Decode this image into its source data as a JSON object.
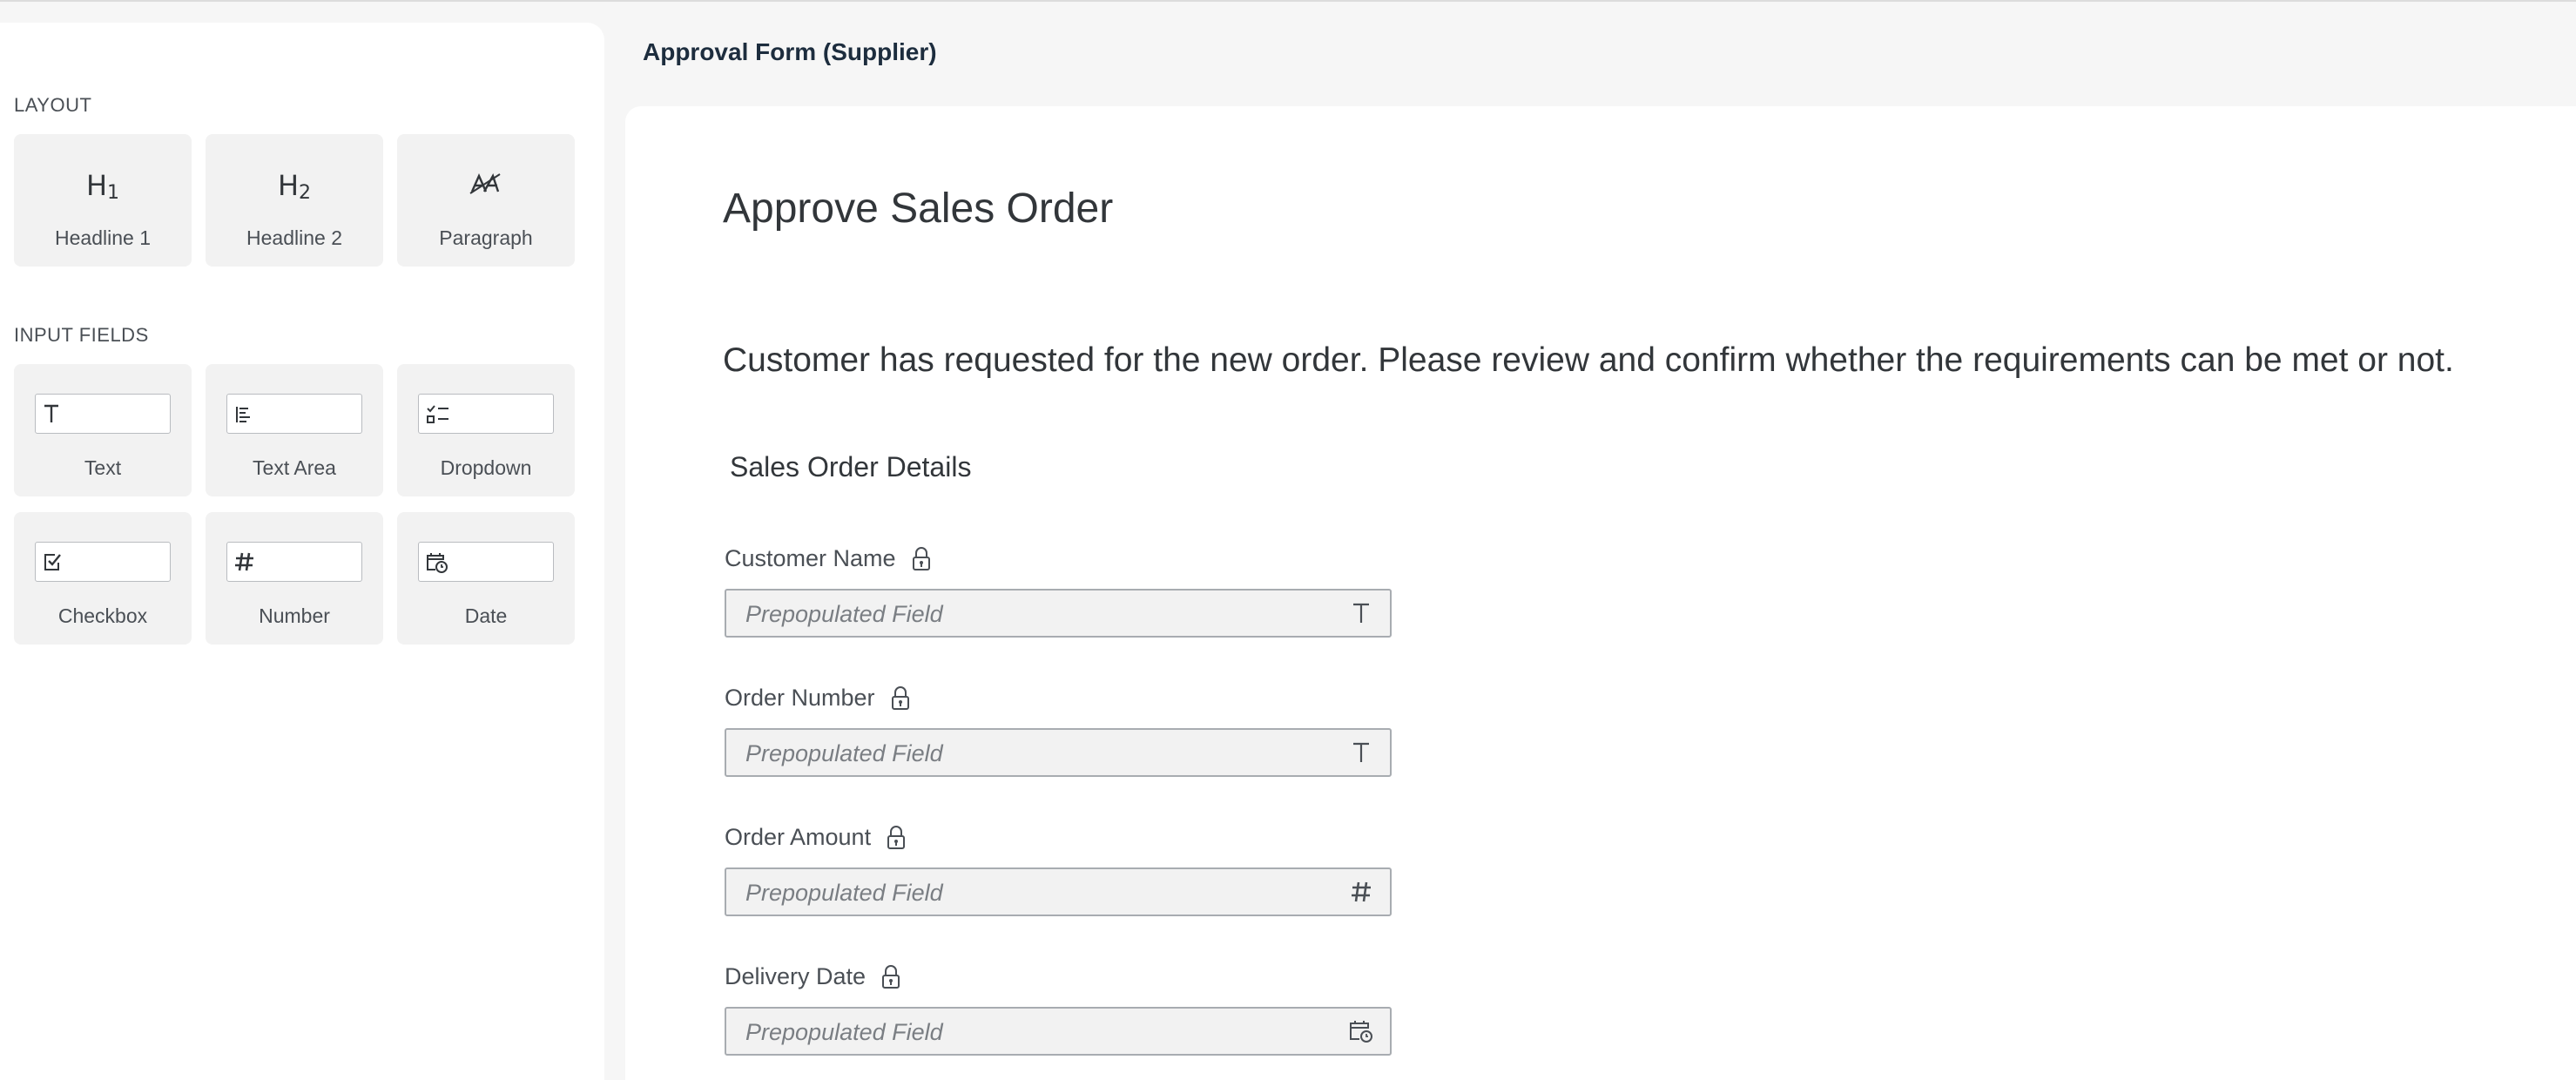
{
  "sidebar": {
    "layout_section": {
      "title": "LAYOUT",
      "items": [
        {
          "label": "Headline 1",
          "icon": "headline-1-icon",
          "glyph": "H",
          "sub": "1"
        },
        {
          "label": "Headline 2",
          "icon": "headline-2-icon",
          "glyph": "H",
          "sub": "2"
        },
        {
          "label": "Paragraph",
          "icon": "paragraph-icon"
        }
      ]
    },
    "input_section": {
      "title": "INPUT FIELDS",
      "items": [
        {
          "label": "Text",
          "icon": "text-field-icon"
        },
        {
          "label": "Text Area",
          "icon": "text-area-icon"
        },
        {
          "label": "Dropdown",
          "icon": "dropdown-icon"
        },
        {
          "label": "Checkbox",
          "icon": "checkbox-icon"
        },
        {
          "label": "Number",
          "icon": "number-icon"
        },
        {
          "label": "Date",
          "icon": "date-icon"
        }
      ]
    }
  },
  "form": {
    "header_title": "Approval Form (Supplier)",
    "headline": "Approve Sales Order",
    "paragraph": "Customer has requested for the new order. Please review and confirm whether the requirements can be met or not.",
    "section_title": "Sales Order Details",
    "fields": [
      {
        "label": "Customer Name",
        "value": "Prepopulated Field",
        "type_icon": "text-type-icon",
        "locked": true
      },
      {
        "label": "Order Number",
        "value": "Prepopulated Field",
        "type_icon": "text-type-icon",
        "locked": true
      },
      {
        "label": "Order Amount",
        "value": "Prepopulated Field",
        "type_icon": "number-type-icon",
        "locked": true
      },
      {
        "label": "Delivery Date",
        "value": "Prepopulated Field",
        "type_icon": "date-type-icon",
        "locked": true
      }
    ]
  },
  "colors": {
    "background": "#f6f6f6",
    "panel": "#ffffff",
    "tile": "#f2f2f2",
    "text": "#32363a",
    "field_border": "#a8acb1"
  }
}
